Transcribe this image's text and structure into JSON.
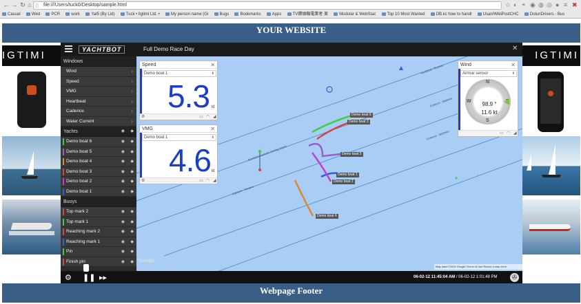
{
  "browser": {
    "url": "file:///Users/tuck0/Desktop/sample.html",
    "bookmarks": [
      "Casual",
      "Wed",
      "PCR",
      "work",
      "Yat5 (By Lid)",
      "Tuck • ligtimi Ltd. •",
      "My person name (Gi",
      "Bugs",
      "Bookmarks",
      "Apps",
      "TV鑽頭機電業者 美",
      "Modular & WebStac",
      "Top 10 Most Wanted",
      "DB.kc how to handl",
      "Usan/WikiPostCHC",
      "DolunDrivers - Bus"
    ]
  },
  "site": {
    "header": "YOUR WEBSITE",
    "footer": "Webpage Footer",
    "logo_text": "IGTIMI"
  },
  "app": {
    "brand": "YACHTBOT",
    "title": "Full Demo Race Day",
    "sections": {
      "windows": "Windows",
      "yachts": "Yachts",
      "buoys": "Buoys"
    },
    "windows": [
      "Wind",
      "Speed",
      "VMG",
      "Heartbeat",
      "Cadence",
      "Water Current"
    ],
    "yachts": [
      {
        "name": "Demo boat 6",
        "color": "#3ccf3c"
      },
      {
        "name": "Demo boat 5",
        "color": "#9a5cc9"
      },
      {
        "name": "Demo boat 4",
        "color": "#e0892c"
      },
      {
        "name": "Demo boat 3",
        "color": "#d24545"
      },
      {
        "name": "Demo boat 2",
        "color": "#c23cd6"
      },
      {
        "name": "Demo boat 1",
        "color": "#2f5fd8"
      }
    ],
    "buoys": [
      {
        "name": "Top mark 2",
        "color": "#d24545"
      },
      {
        "name": "Top mark 1",
        "color": "#3ccf3c"
      },
      {
        "name": "Reaching mark 2",
        "color": "#d24545"
      },
      {
        "name": "Reaching mark 1",
        "color": "#2f5fd8"
      },
      {
        "name": "Pin",
        "color": "#3ccf3c"
      },
      {
        "name": "Finish pin",
        "color": "#d24545"
      }
    ],
    "timestamp_current": "06-02-12 11:45:04 AM",
    "timestamp_end": "/ 06-02-12 1:01:48 PM"
  },
  "speed_panel": {
    "title": "Speed",
    "boat": "Demo boat 1",
    "value": "5.3",
    "unit": "kt"
  },
  "vmg_panel": {
    "title": "VMG",
    "boat": "Demo boat 1",
    "value": "4.6",
    "unit": "kt"
  },
  "wind_panel": {
    "title": "Wind",
    "sensor": "Airmar sensor",
    "direction": "98.9 °",
    "speed": "11.6 kt",
    "cardinals": [
      "N",
      "E",
      "S",
      "W"
    ]
  },
  "map": {
    "boat_labels": [
      "Demo boat 6",
      "Demo boat 3",
      "Demo boat 5",
      "Demo boat 1",
      "Demo boat 2",
      "Demo boat 4"
    ],
    "course_lines": [
      "Auckland - Rarawa",
      "Dotmont - Waiheke",
      "Auckland Aramoho Darling Island",
      "Dotmont - Rarawa",
      "Dotmont - Waiheke"
    ],
    "google": "Google",
    "attribution": "Map data ©2015 Google   Terms of Use   Report a map error"
  }
}
